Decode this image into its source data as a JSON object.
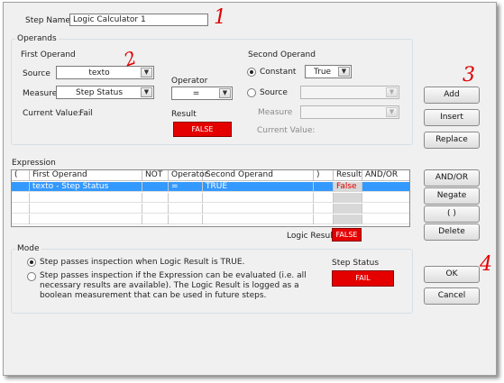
{
  "step": {
    "name_label": "Step Name",
    "name_value": "Logic Calculator 1"
  },
  "operands": {
    "title": "Operands",
    "first": {
      "title": "First Operand",
      "source_label": "Source",
      "source_value": "texto",
      "measure_label": "Measure",
      "measure_value": "Step Status",
      "current_value_label": "Current Value:",
      "current_value": "Fail"
    },
    "operator": {
      "label": "Operator",
      "value": "="
    },
    "result": {
      "label": "Result",
      "value": "FALSE"
    },
    "second": {
      "title": "Second Operand",
      "constant_label": "Constant",
      "constant_value": "True",
      "source_label": "Source",
      "source_value": "",
      "measure_label": "Measure",
      "measure_value": "",
      "current_value_label": "Current Value:"
    }
  },
  "operand_buttons": {
    "add": "Add",
    "insert": "Insert",
    "replace": "Replace"
  },
  "expression": {
    "title": "Expression",
    "columns": [
      "(",
      "First Operand",
      "NOT",
      "Operator",
      "Second Operand",
      ")",
      "Result",
      "AND/OR"
    ],
    "rows": [
      {
        "open": "",
        "first": "texto - Step Status",
        "not": "",
        "operator": "=",
        "second": "TRUE",
        "close": "",
        "result": "False",
        "andor": ""
      }
    ],
    "logic_result_label": "Logic Result",
    "logic_result_value": "FALSE"
  },
  "expression_buttons": {
    "andor": "AND/OR",
    "negate": "Negate",
    "parens": "( )",
    "delete": "Delete"
  },
  "mode": {
    "title": "Mode",
    "option1": "Step passes inspection when Logic Result is TRUE.",
    "option2": "Step passes inspection if the Expression can be evaluated (i.e. all necessary results are available). The Logic Result is logged as a boolean measurement that can be used in future steps.",
    "step_status_label": "Step Status",
    "step_status_value": "FAIL"
  },
  "dialog_buttons": {
    "ok": "OK",
    "cancel": "Cancel"
  },
  "annotations": {
    "n1": "1",
    "n2": "2",
    "n3": "3",
    "n4": "4"
  },
  "colors": {
    "accent_red": "#e50000",
    "selection": "#3399ff",
    "annotation_ink": "#e00000"
  },
  "icons": {
    "dropdown": "chevron-down-icon",
    "radio": "radio-icon"
  }
}
